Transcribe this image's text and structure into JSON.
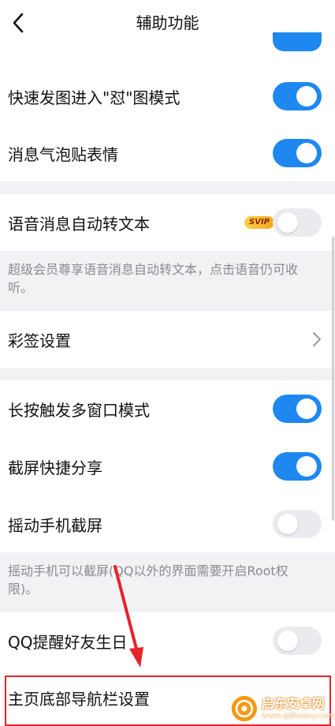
{
  "header": {
    "title": "辅助功能"
  },
  "rows": {
    "quick_image": {
      "label": "快速发图进入\"怼\"图模式",
      "toggle": "on"
    },
    "bubble_sticker": {
      "label": "消息气泡贴表情",
      "toggle": "on"
    },
    "voice_to_text": {
      "label": "语音消息自动转文本",
      "badge": "SVIP",
      "toggle": "off"
    },
    "voice_note": "超级会员尊享语音消息自动转文本，点击语音仍可收听。",
    "color_tag": {
      "label": "彩签设置"
    },
    "multi_window": {
      "label": "长按触发多窗口模式",
      "toggle": "on"
    },
    "screenshot_share": {
      "label": "截屏快捷分享",
      "toggle": "on"
    },
    "shake_screenshot": {
      "label": "摇动手机截屏",
      "toggle": "off"
    },
    "shake_note": "摇动手机可以截屏(QQ以外的界面需要开启Root权限)。",
    "birthday": {
      "label": "QQ提醒好友生日",
      "toggle": "off"
    },
    "bottom_nav": {
      "label": "主页底部导航栏设置"
    }
  },
  "watermark": {
    "title": "启东安卓网",
    "url": "www.qdhuaxy.com"
  },
  "colors": {
    "accent": "#1e88f0",
    "highlight": "#e5232a"
  }
}
